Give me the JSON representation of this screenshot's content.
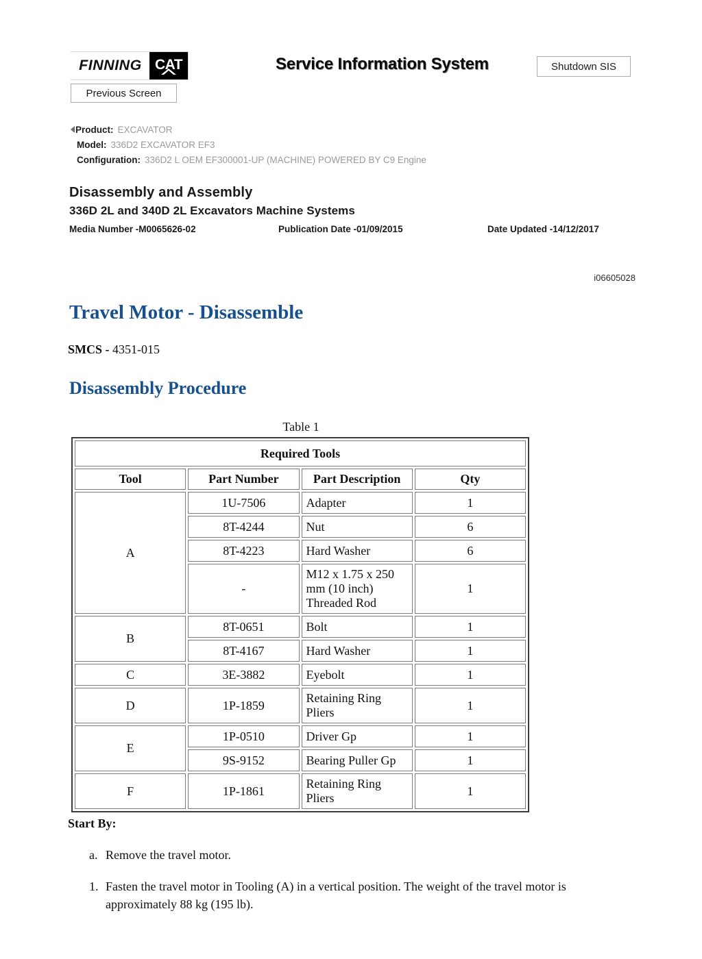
{
  "header": {
    "logo_brand": "FINNING",
    "logo_cat": "CAT",
    "sis_title": "Service Information System",
    "shutdown_button": "Shutdown SIS",
    "previous_button": "Previous Screen"
  },
  "breadcrumb": {
    "product_label": "Product:",
    "product_value": "EXCAVATOR",
    "model_label": "Model:",
    "model_value": "336D2 EXCAVATOR EF3",
    "configuration_label": "Configuration:",
    "configuration_value": "336D2 L OEM EF300001-UP (MACHINE) POWERED BY C9 Engine"
  },
  "document": {
    "title": "Disassembly and Assembly",
    "subtitle": "336D 2L and 340D 2L Excavators Machine Systems",
    "media_number": "Media Number -M0065626-02",
    "publication_date": "Publication Date -01/09/2015",
    "date_updated": "Date Updated -14/12/2017",
    "doc_id": "i06605028"
  },
  "content": {
    "heading": "Travel Motor - Disassemble",
    "smcs_label": "SMCS -",
    "smcs_value": "4351-015",
    "section_heading": "Disassembly Procedure",
    "table_caption": "Table 1",
    "start_by_label": "Start By:",
    "sub_steps": [
      {
        "marker": "a.",
        "text": "Remove the travel motor."
      }
    ],
    "steps": [
      {
        "marker": "1.",
        "text": "Fasten the travel motor in Tooling (A) in a vertical position. The weight of the travel motor is approximately 88 kg (195 lb)."
      }
    ]
  },
  "table": {
    "title": "Required Tools",
    "headers": {
      "tool": "Tool",
      "part_number": "Part Number",
      "part_description": "Part Description",
      "qty": "Qty"
    },
    "rows": [
      {
        "tool": "A",
        "tool_span": 4,
        "part_number": "1U-7506",
        "description": "Adapter",
        "qty": "1"
      },
      {
        "tool": "",
        "tool_span": 0,
        "part_number": "8T-4244",
        "description": "Nut",
        "qty": "6"
      },
      {
        "tool": "",
        "tool_span": 0,
        "part_number": "8T-4223",
        "description": "Hard Washer",
        "qty": "6"
      },
      {
        "tool": "",
        "tool_span": 0,
        "part_number": "-",
        "description": "M12 x 1.75 x 250 mm (10 inch) Threaded Rod",
        "qty": "1"
      },
      {
        "tool": "B",
        "tool_span": 2,
        "part_number": "8T-0651",
        "description": "Bolt",
        "qty": "1"
      },
      {
        "tool": "",
        "tool_span": 0,
        "part_number": "8T-4167",
        "description": "Hard Washer",
        "qty": "1"
      },
      {
        "tool": "C",
        "tool_span": 1,
        "part_number": "3E-3882",
        "description": "Eyebolt",
        "qty": "1"
      },
      {
        "tool": "D",
        "tool_span": 1,
        "part_number": "1P-1859",
        "description": "Retaining Ring Pliers",
        "qty": "1"
      },
      {
        "tool": "E",
        "tool_span": 2,
        "part_number": "1P-0510",
        "description": "Driver Gp",
        "qty": "1"
      },
      {
        "tool": "",
        "tool_span": 0,
        "part_number": "9S-9152",
        "description": "Bearing Puller Gp",
        "qty": "1"
      },
      {
        "tool": "F",
        "tool_span": 1,
        "part_number": "1P-1861",
        "description": "Retaining Ring Pliers",
        "qty": "1"
      }
    ]
  },
  "colors": {
    "heading_blue": "#17508f",
    "text_black": "#111111",
    "breadcrumb_gray": "#9a9a9a"
  }
}
